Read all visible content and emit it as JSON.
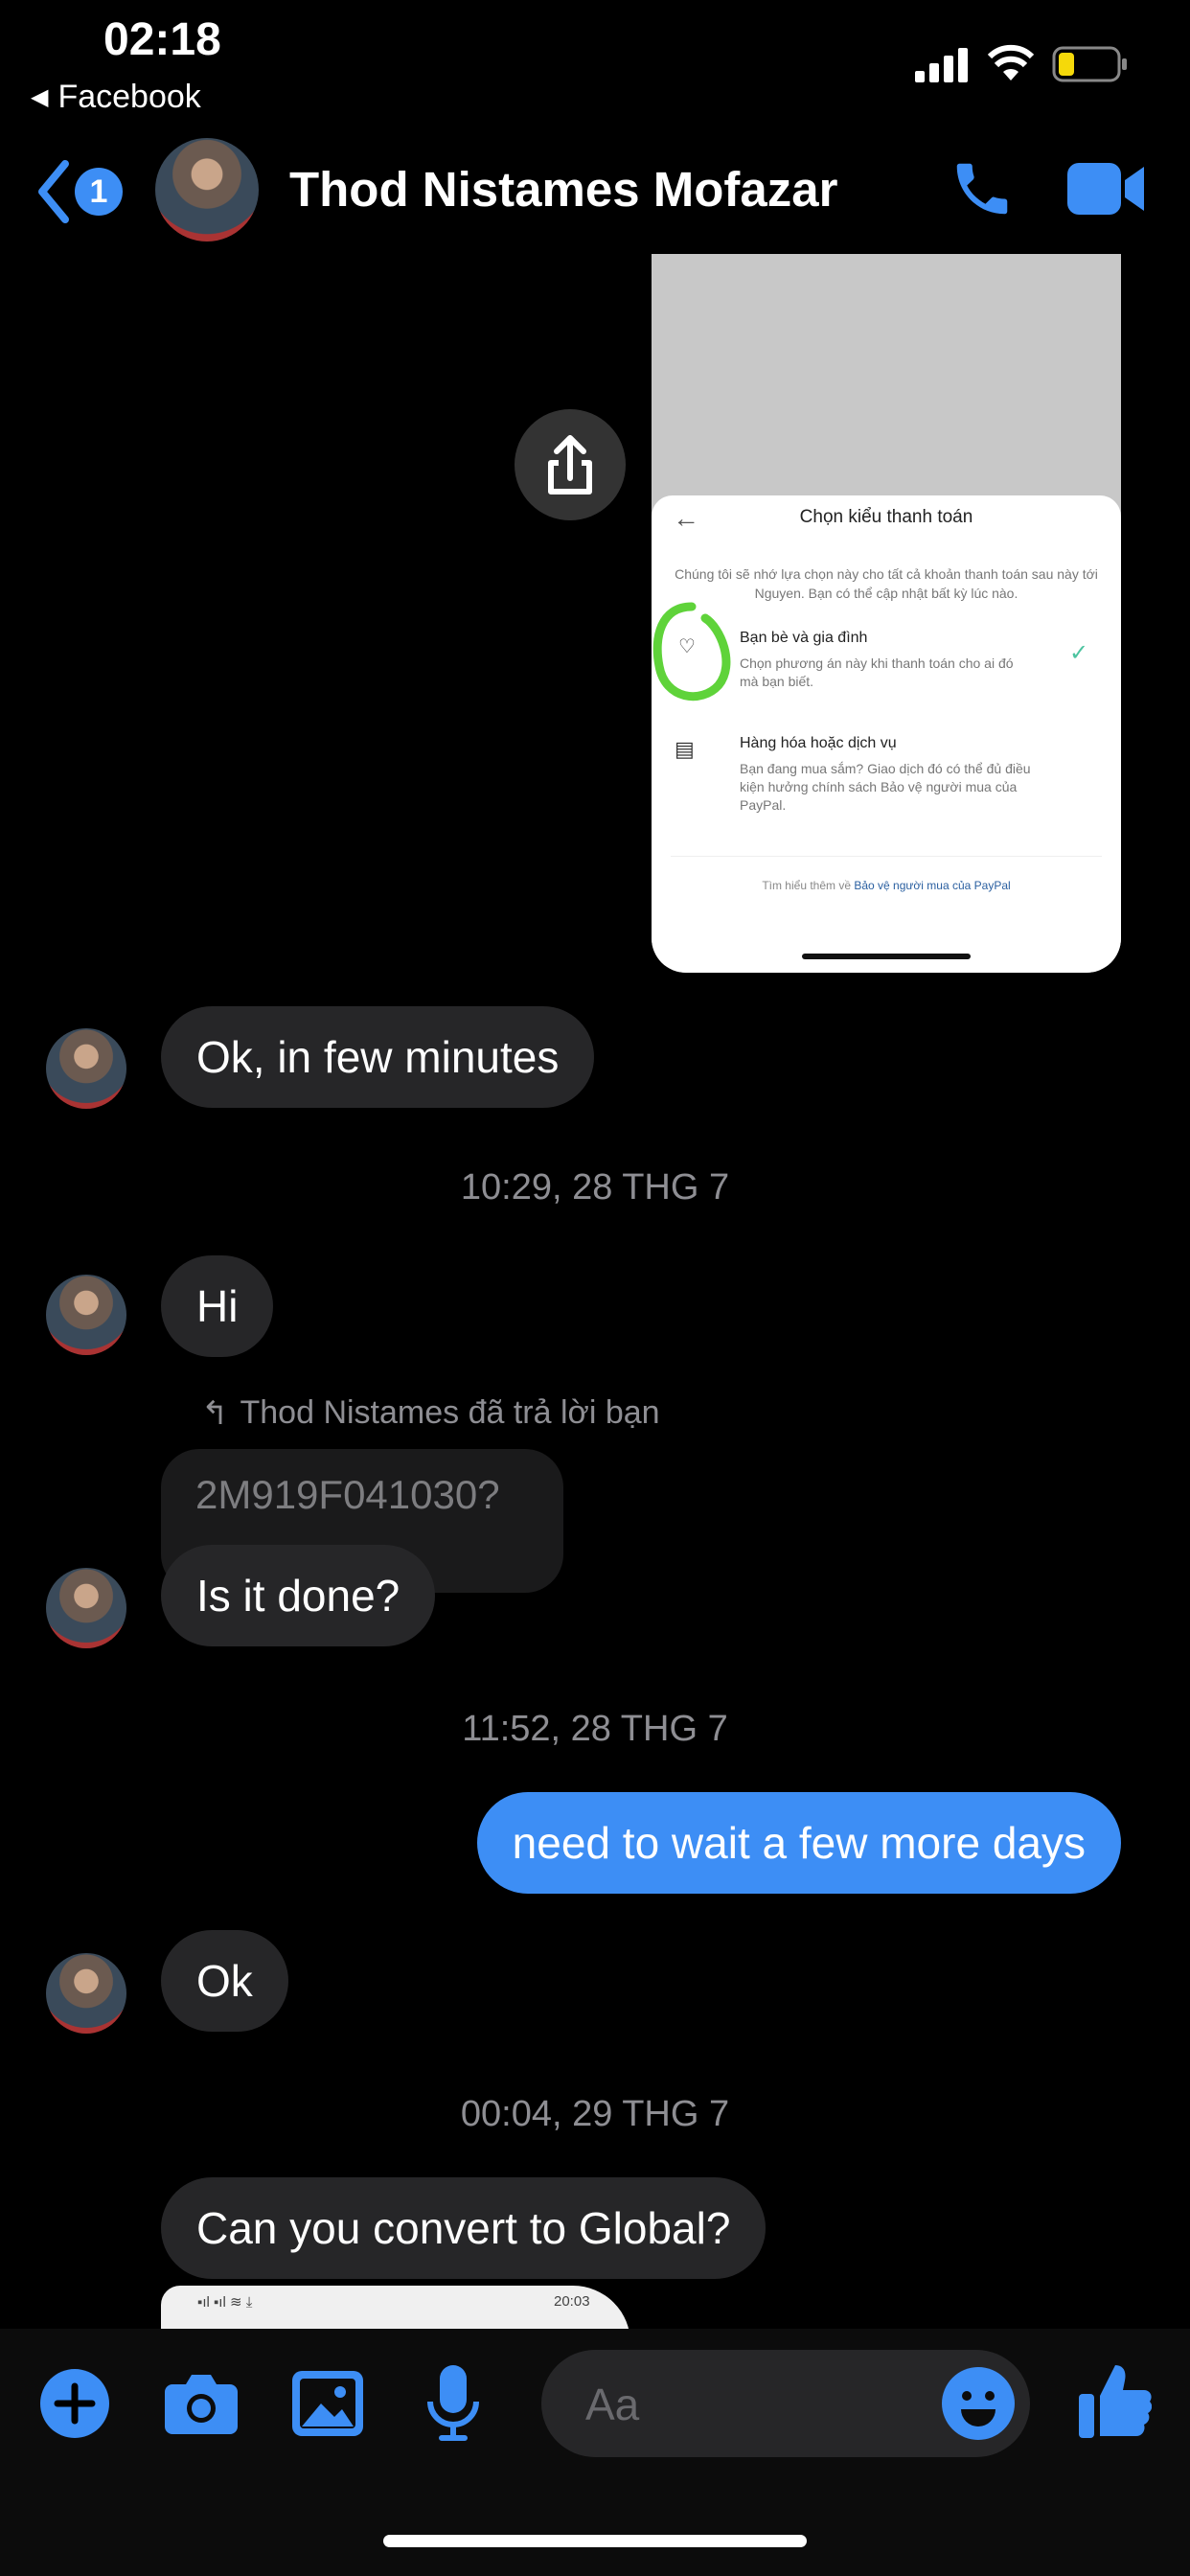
{
  "status": {
    "time": "02:18",
    "back_app": "Facebook"
  },
  "header": {
    "unread_count": "1",
    "contact_name": "Thod Nistames Mofazar"
  },
  "shared_image": {
    "title": "Chọn kiểu thanh toán",
    "intro": "Chúng tôi sẽ nhớ lựa chọn này cho tất cả khoản thanh toán sau này tới Nguyen. Bạn có thể cập nhật bất kỳ lúc nào.",
    "option1_title": "Bạn bè và gia đình",
    "option1_desc": "Chọn phương án này khi thanh toán cho ai đó mà bạn biết.",
    "option2_title": "Hàng hóa hoặc dịch vụ",
    "option2_desc": "Bạn đang mua sắm? Giao dịch đó có thể đủ điều kiện hưởng chính sách Bảo vệ người mua của PayPal.",
    "footer_prefix": "Tìm hiểu thêm về ",
    "footer_link": "Bảo vệ người mua của PayPal"
  },
  "messages": [
    {
      "text": "Ok, in few minutes"
    },
    {
      "timestamp": "10:29, 28 THG 7"
    },
    {
      "text": "Hi"
    },
    {
      "reply_label": "Thod Nistames đã trả lời bạn",
      "quoted": "2M919F041030?"
    },
    {
      "text": "Is it done?"
    },
    {
      "timestamp": "11:52, 28 THG 7"
    },
    {
      "text": "need to wait a few more days"
    },
    {
      "text": "Ok"
    },
    {
      "timestamp": "00:04, 29 THG 7"
    },
    {
      "text": "Can you convert to Global?"
    }
  ],
  "partial_image": {
    "time": "20:03"
  },
  "composer": {
    "placeholder": "Aa"
  },
  "colors": {
    "accent": "#3d8ef5",
    "bubble": "#262628",
    "green_mark": "#5fd33a"
  }
}
